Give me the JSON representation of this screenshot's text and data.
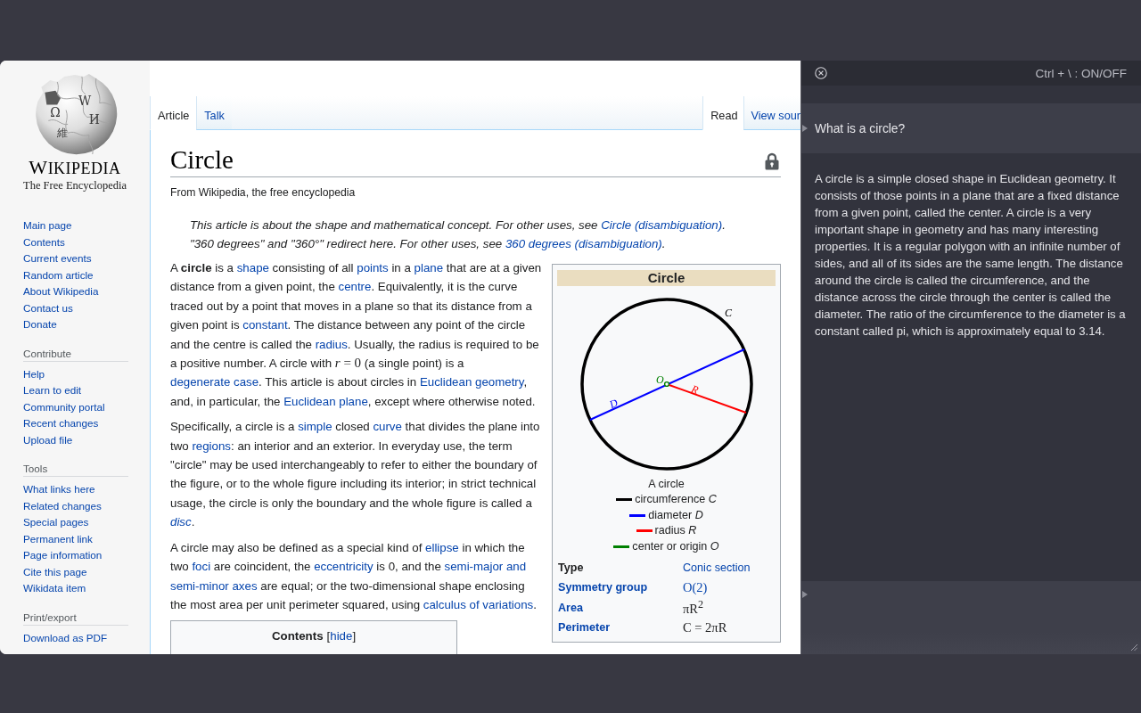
{
  "sidebar": {
    "logo": {
      "glyphs": [
        "Ω",
        "W",
        "И",
        "維"
      ],
      "wordmark": "WIKIPEDIA",
      "tagline": "The Free Encyclopedia"
    },
    "main_links": [
      "Main page",
      "Contents",
      "Current events",
      "Random article",
      "About Wikipedia",
      "Contact us",
      "Donate"
    ],
    "sections": [
      {
        "heading": "Contribute",
        "links": [
          "Help",
          "Learn to edit",
          "Community portal",
          "Recent changes",
          "Upload file"
        ]
      },
      {
        "heading": "Tools",
        "links": [
          "What links here",
          "Related changes",
          "Special pages",
          "Permanent link",
          "Page information",
          "Cite this page",
          "Wikidata item"
        ]
      },
      {
        "heading": "Print/export",
        "links": [
          "Download as PDF"
        ]
      }
    ]
  },
  "tabs": {
    "left": [
      {
        "label": "Article",
        "selected": true
      },
      {
        "label": "Talk",
        "selected": false
      }
    ],
    "right": [
      {
        "label": "Read",
        "selected": true
      },
      {
        "label": "View sour",
        "selected": false
      }
    ]
  },
  "article": {
    "title": "Circle",
    "subtitle": "From Wikipedia, the free encyclopedia",
    "hatnotes": [
      [
        {
          "kind": "text",
          "s": "This article is about the shape and mathematical concept. For other uses, see "
        },
        {
          "kind": "link",
          "s": "Circle (disambiguation)"
        },
        {
          "kind": "text",
          "s": "."
        }
      ],
      [
        {
          "kind": "text",
          "s": "\"360 degrees\" and \"360°\" redirect here. For other uses, see "
        },
        {
          "kind": "link",
          "s": "360 degrees (disambiguation)"
        },
        {
          "kind": "text",
          "s": "."
        }
      ]
    ],
    "paragraphs": [
      [
        {
          "kind": "text",
          "s": "A **circle** is a "
        },
        {
          "kind": "link",
          "s": "shape"
        },
        {
          "kind": "text",
          "s": " consisting of all "
        },
        {
          "kind": "link",
          "s": "points"
        },
        {
          "kind": "text",
          "s": " in a "
        },
        {
          "kind": "link",
          "s": "plane"
        },
        {
          "kind": "text",
          "s": " that are at a given distance from a given point, the "
        },
        {
          "kind": "link",
          "s": "centre"
        },
        {
          "kind": "text",
          "s": ". Equivalently, it is the curve traced out by a point that moves in a plane so that its distance from a given point is "
        },
        {
          "kind": "link",
          "s": "constant"
        },
        {
          "kind": "text",
          "s": ". The distance between any point of the circle and the centre is called the "
        },
        {
          "kind": "link",
          "s": "radius"
        },
        {
          "kind": "text",
          "s": ". Usually, the radius is required to be a positive number. A circle with "
        },
        {
          "kind": "math",
          "s": "*r* = 0"
        },
        {
          "kind": "text",
          "s": " (a single point) is a "
        },
        {
          "kind": "link",
          "s": "degenerate case"
        },
        {
          "kind": "text",
          "s": ". This article is about circles in "
        },
        {
          "kind": "link",
          "s": "Euclidean geometry"
        },
        {
          "kind": "text",
          "s": ", and, in particular, the "
        },
        {
          "kind": "link",
          "s": "Euclidean plane"
        },
        {
          "kind": "text",
          "s": ", except where otherwise noted."
        }
      ],
      [
        {
          "kind": "text",
          "s": "Specifically, a circle is a "
        },
        {
          "kind": "link",
          "s": "simple"
        },
        {
          "kind": "text",
          "s": " closed "
        },
        {
          "kind": "link",
          "s": "curve"
        },
        {
          "kind": "text",
          "s": " that divides the plane into two "
        },
        {
          "kind": "link",
          "s": "regions"
        },
        {
          "kind": "text",
          "s": ": an interior and an exterior. In everyday use, the term \"circle\" may be used interchangeably to refer to either the boundary of the figure, or to the whole figure including its interior; in strict technical usage, the circle is only the boundary and the whole figure is called a "
        },
        {
          "kind": "link",
          "s": "*disc*"
        },
        {
          "kind": "text",
          "s": "."
        }
      ],
      [
        {
          "kind": "text",
          "s": "A circle may also be defined as a special kind of "
        },
        {
          "kind": "link",
          "s": "ellipse"
        },
        {
          "kind": "text",
          "s": " in which the two "
        },
        {
          "kind": "link",
          "s": "foci"
        },
        {
          "kind": "text",
          "s": " are coincident, the "
        },
        {
          "kind": "link",
          "s": "eccentricity"
        },
        {
          "kind": "text",
          "s": " is 0, and the "
        },
        {
          "kind": "link",
          "s": "semi-major and"
        },
        {
          "kind": "link",
          "s": " semi-minor axes"
        },
        {
          "kind": "text",
          "s": " are equal; or the two-dimensional shape enclosing the most area per unit perimeter squared, using "
        },
        {
          "kind": "link",
          "s": "calculus of variations"
        },
        {
          "kind": "text",
          "s": "."
        }
      ]
    ],
    "contents": {
      "title": "Contents",
      "bracket_open": "[",
      "toggle": "hide",
      "bracket_close": "]"
    }
  },
  "infobox": {
    "title": "Circle",
    "figure_labels": {
      "circumference": "C",
      "center": "O",
      "diameter": "D",
      "radius": "R"
    },
    "caption": "A circle",
    "legend": [
      {
        "label": "circumference *C*",
        "color": "#000000"
      },
      {
        "label": "diameter *D*",
        "color": "#0000ff"
      },
      {
        "label": "radius *R*",
        "color": "#ff0000"
      },
      {
        "label": "center or origin *O*",
        "color": "#008000"
      }
    ],
    "rows": [
      {
        "label": "Type",
        "label_link": false,
        "value": "Conic section",
        "value_link": true,
        "value_math": false
      },
      {
        "label": "Symmetry group",
        "label_link": true,
        "value": "O(2)",
        "value_link": true,
        "value_math": true
      },
      {
        "label": "Area",
        "label_link": true,
        "value": "πR$^{2}$",
        "value_link": false,
        "value_math": true
      },
      {
        "label": "Perimeter",
        "label_link": true,
        "value": "C = 2πR",
        "value_link": false,
        "value_math": true
      }
    ]
  },
  "assistant": {
    "shortcut": "Ctrl + \\ : ON/OFF",
    "question": "What is a circle?",
    "answer": "A circle is a simple closed shape in Euclidean geometry. It consists of those points in a plane that are a fixed distance from a given point, called the center. A circle is a very important shape in geometry and has many interesting properties. It is a regular polygon with an infinite number of sides, and all of its sides are the same length. The distance around the circle is called the circumference, and the distance across the circle through the center is called the diameter. The ratio of the circumference to the diameter is a constant called pi, which is approximately equal to 3.14."
  }
}
